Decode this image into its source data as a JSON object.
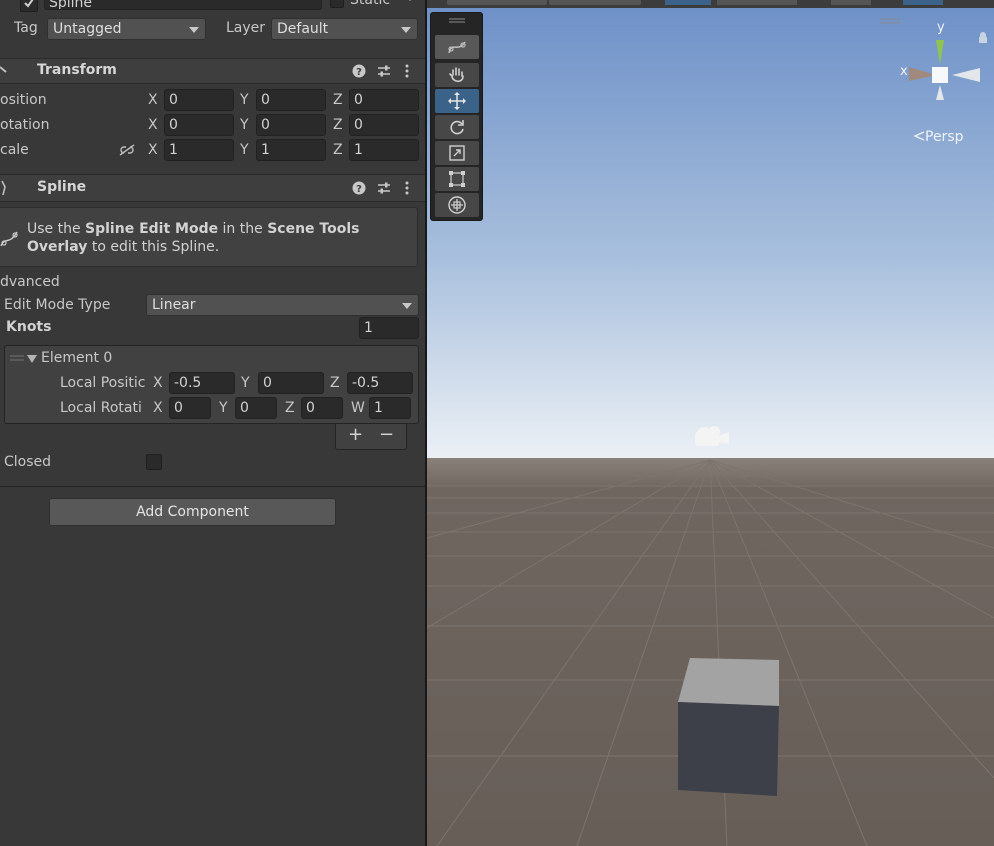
{
  "header": {
    "object_name": "Spline",
    "static_label": "Static",
    "tag_label": "Tag",
    "tag_value": "Untagged",
    "layer_label": "Layer",
    "layer_value": "Default"
  },
  "transform": {
    "title": "Transform",
    "rows": [
      {
        "label": "osition",
        "x": "0",
        "y": "0",
        "z": "0"
      },
      {
        "label": "otation",
        "x": "0",
        "y": "0",
        "z": "0"
      },
      {
        "label": "cale",
        "x": "1",
        "y": "1",
        "z": "1"
      }
    ],
    "axis_x": "X",
    "axis_y": "Y",
    "axis_z": "Z"
  },
  "spline": {
    "title": "Spline",
    "info_pre": "Use the ",
    "info_bold1": "Spline Edit Mode",
    "info_mid": " in the ",
    "info_bold2": "Scene Tools",
    "info_bold3": "Overlay",
    "info_post": " to edit this Spline.",
    "advanced_label": "dvanced",
    "edit_mode_label": "Edit Mode Type",
    "edit_mode_value": "Linear",
    "knots_label": "Knots",
    "knots_count": "1",
    "element_label": "Element 0",
    "local_position_label": "Local Positic",
    "local_rotation_label": "Local Rotati",
    "pos": {
      "x": "-0.5",
      "y": "0",
      "z": "-0.5"
    },
    "rot": {
      "x": "0",
      "y": "0",
      "z": "0",
      "w": "1"
    },
    "axis_w": "W",
    "add_symbol": "+",
    "remove_symbol": "−",
    "closed_label": "Closed"
  },
  "add_component_label": "Add Component",
  "scene": {
    "persp_label": "Persp",
    "gizmo_x": "x",
    "gizmo_y": "y"
  },
  "colors": {
    "sky_top": "#6f93c9",
    "sky_bottom": "#e8eef4",
    "ground": "#6b625c",
    "tool_active": "#3b6289"
  }
}
